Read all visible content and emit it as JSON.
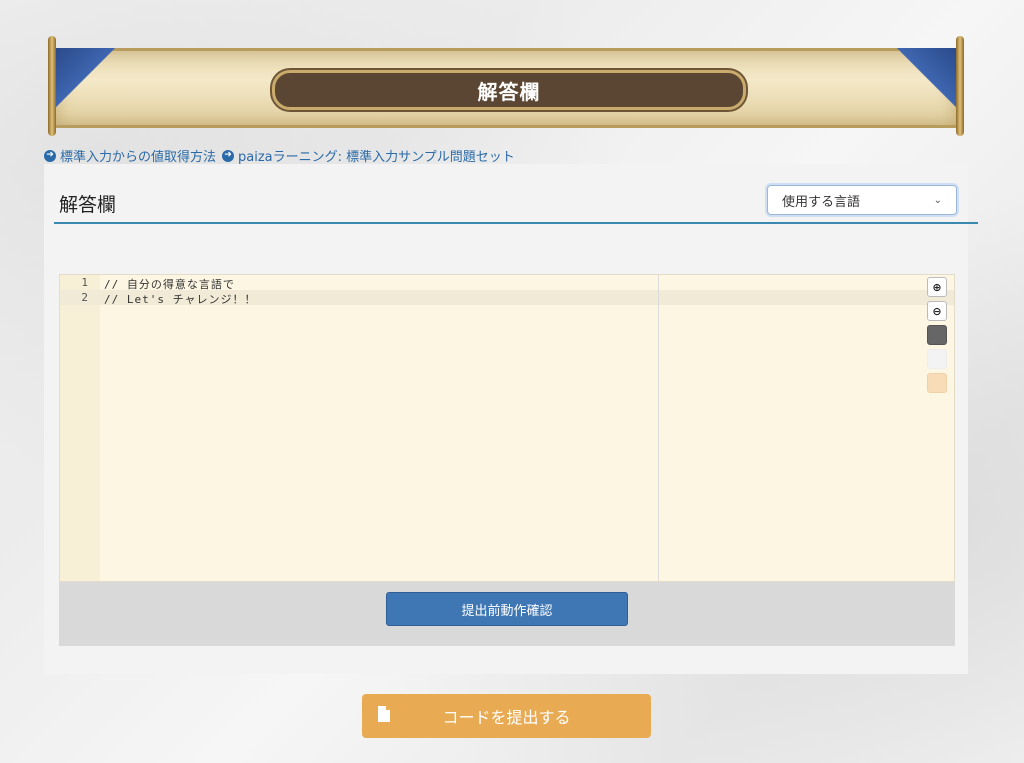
{
  "banner": {
    "title": "解答欄"
  },
  "links": [
    {
      "label": "標準入力からの値取得方法"
    },
    {
      "label": "paizaラーニング: 標準入力サンプル問題セット"
    }
  ],
  "panel": {
    "title": "解答欄",
    "language_select": {
      "value": "使用する言語"
    }
  },
  "editor": {
    "lines": [
      {
        "number": "1",
        "code": "// 自分の得意な言語で"
      },
      {
        "number": "2",
        "code": "// Let's チャレンジ！！"
      }
    ],
    "tools": {
      "zoom_in_icon": "zoom-in-icon",
      "zoom_out_icon": "zoom-out-icon",
      "theme_colors": [
        "#666666",
        "#f3f3f3",
        "#f8dcb8"
      ]
    }
  },
  "actions": {
    "check_label": "提出前動作確認",
    "submit_label": "コードを提出する"
  },
  "colors": {
    "accent": "#3a88b0",
    "check_button": "#3f77b5",
    "submit_button": "#e8ab53",
    "link": "#2a6aa8"
  }
}
